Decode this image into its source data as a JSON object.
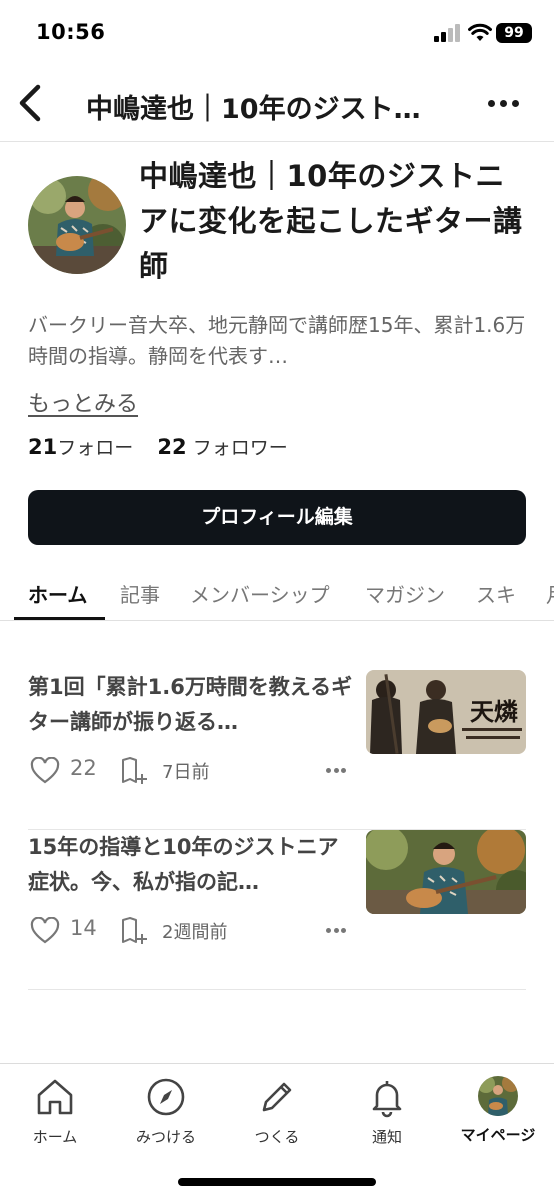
{
  "status_bar": {
    "time": "10:56",
    "battery": "99"
  },
  "nav": {
    "title": "中嶋達也｜10年のジスト…"
  },
  "profile": {
    "name": "中嶋達也｜10年のジストニアに変化を起こしたギター講師",
    "bio": "バークリー音大卒、地元静岡で講師歴15年、累計1.6万時間の指導。静岡を代表す…",
    "more_label": "もっとみる",
    "following_count": "21",
    "following_label": "フォロー",
    "followers_count": "22",
    "followers_label": "フォロワー",
    "edit_button": "プロフィール編集"
  },
  "tabs": [
    {
      "label": "ホーム",
      "active": true
    },
    {
      "label": "記事"
    },
    {
      "label": "メンバーシップ"
    },
    {
      "label": "マガジン"
    },
    {
      "label": "スキ"
    },
    {
      "label": "月"
    }
  ],
  "articles": [
    {
      "title": "第1回「累計1.6万時間を教えるギター講師が振り返る…",
      "likes": "22",
      "date": "7日前",
      "thumb_text": "天燐"
    },
    {
      "title": "15年の指導と10年のジストニア症状。今、私が指の記…",
      "likes": "14",
      "date": "2週間前"
    }
  ],
  "bottom_tabs": [
    {
      "label": "ホーム",
      "icon": "home-icon"
    },
    {
      "label": "みつける",
      "icon": "compass-icon"
    },
    {
      "label": "つくる",
      "icon": "pencil-icon"
    },
    {
      "label": "通知",
      "icon": "bell-icon"
    },
    {
      "label": "マイページ",
      "icon": "avatar"
    }
  ],
  "colors": {
    "button_bg": "#0f1419",
    "text_dark": "#1a1a1a",
    "text_muted": "#666666"
  }
}
